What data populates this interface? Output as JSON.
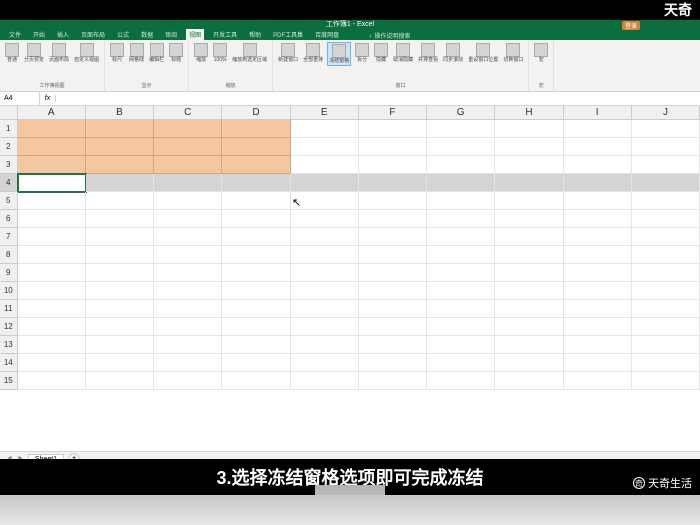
{
  "top_brand": "天奇",
  "titlebar": {
    "title": "工作簿1 - Excel",
    "login": "登录"
  },
  "tabs": {
    "items": [
      "文件",
      "开始",
      "插入",
      "页面布局",
      "公式",
      "数据",
      "审阅",
      "视图",
      "开发工具",
      "帮助",
      "PDF工具集",
      "百度网盘"
    ],
    "active_index": 7,
    "tell_me": "操作说明搜索"
  },
  "ribbon": {
    "groups": [
      {
        "name": "工作簿视图",
        "buttons": [
          "普通",
          "分页预览",
          "页面布局",
          "自定义视图"
        ]
      },
      {
        "name": "显示",
        "buttons": [
          "标尺",
          "网格线",
          "编辑栏",
          "标题"
        ]
      },
      {
        "name": "缩放",
        "buttons": [
          "缩放",
          "100%",
          "缩放到选定区域"
        ]
      },
      {
        "name": "窗口",
        "buttons": [
          "新建窗口",
          "全部重排",
          "冻结窗格",
          "拆分",
          "隐藏",
          "取消隐藏",
          "并排查看",
          "同步滚动",
          "重设窗口位置",
          "切换窗口"
        ]
      },
      {
        "name": "宏",
        "buttons": [
          "宏"
        ]
      }
    ],
    "highlighted_button": "冻结窗格"
  },
  "formula_bar": {
    "name_box": "A4",
    "fx": "fx",
    "value": ""
  },
  "grid": {
    "columns": [
      "A",
      "B",
      "C",
      "D",
      "E",
      "F",
      "G",
      "H",
      "I",
      "J"
    ],
    "row_count": 15,
    "highlight_range": {
      "rows": [
        1,
        2,
        3
      ],
      "cols": [
        "A",
        "B",
        "C",
        "D"
      ]
    },
    "selected_row": 4,
    "active_cell": "A4"
  },
  "sheet_tabs": {
    "active": "Sheet1"
  },
  "caption": "3.选择冻结窗格选项即可完成冻结",
  "watermark": "天奇生活"
}
